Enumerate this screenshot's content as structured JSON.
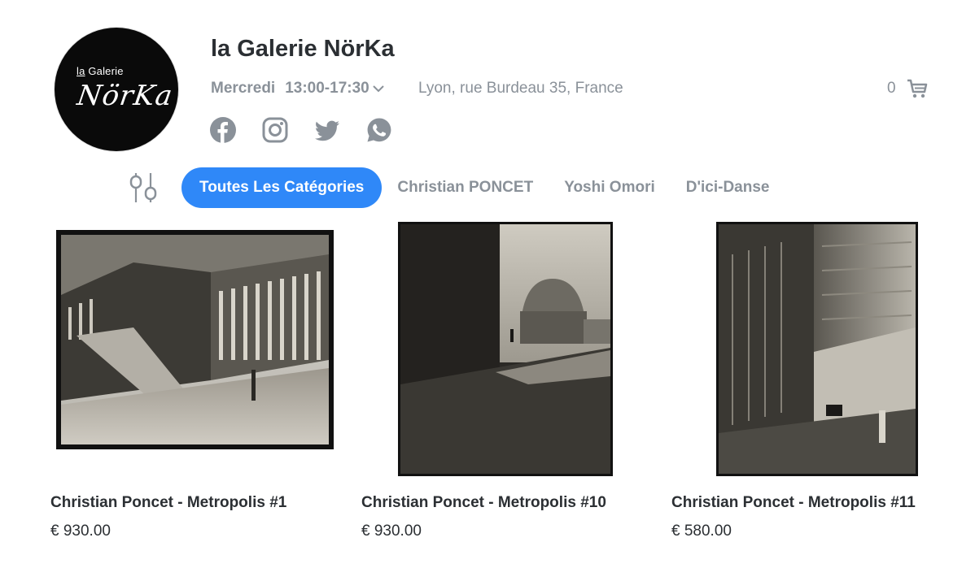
{
  "shop": {
    "logo_small_prefix": "la",
    "logo_small_rest": " Galerie",
    "logo_script": "NörKa",
    "title": "la Galerie NörKa"
  },
  "hours": {
    "day": "Mercredi",
    "time": "13:00-17:30"
  },
  "address": "Lyon, rue Burdeau 35, France",
  "cart": {
    "count": "0"
  },
  "socials": [
    "facebook-icon",
    "instagram-icon",
    "twitter-icon",
    "whatsapp-icon"
  ],
  "categories": [
    {
      "label": "Toutes Les Catégories",
      "active": true
    },
    {
      "label": "Christian PONCET",
      "active": false
    },
    {
      "label": "Yoshi Omori",
      "active": false
    },
    {
      "label": "D'ici-Danse",
      "active": false
    }
  ],
  "products": [
    {
      "name": "Christian Poncet - Metropolis #1",
      "price": "€ 930.00"
    },
    {
      "name": "Christian Poncet - Metropolis #10",
      "price": "€ 930.00"
    },
    {
      "name": "Christian Poncet - Metropolis #11",
      "price": "€ 580.00"
    }
  ],
  "colors": {
    "accent": "#2f88f8",
    "muted": "#8a9199",
    "text": "#2b2f33"
  }
}
